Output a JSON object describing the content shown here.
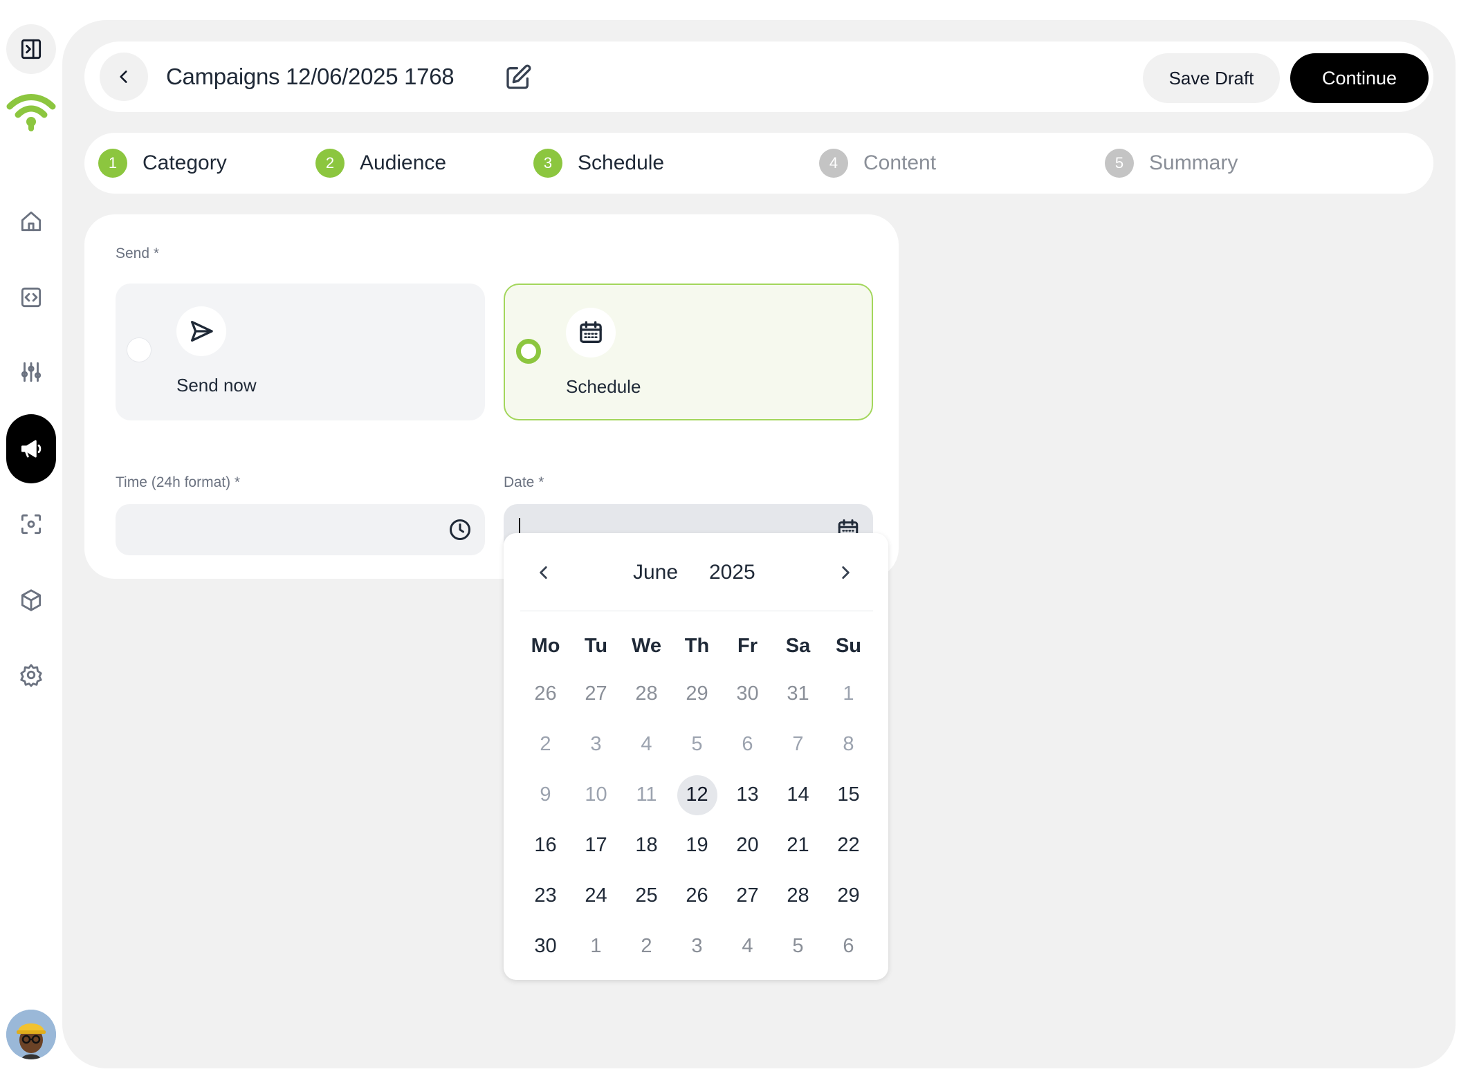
{
  "header": {
    "title": "Campaigns 12/06/2025 1768",
    "save_draft": "Save Draft",
    "continue": "Continue"
  },
  "steps": [
    {
      "num": "1",
      "label": "Category",
      "state": "done"
    },
    {
      "num": "2",
      "label": "Audience",
      "state": "done"
    },
    {
      "num": "3",
      "label": "Schedule",
      "state": "done"
    },
    {
      "num": "4",
      "label": "Content",
      "state": "todo"
    },
    {
      "num": "5",
      "label": "Summary",
      "state": "todo"
    }
  ],
  "send": {
    "label": "Send *",
    "options": [
      {
        "label": "Send now",
        "icon": "send-icon",
        "selected": false
      },
      {
        "label": "Schedule",
        "icon": "calendar-icon",
        "selected": true
      }
    ]
  },
  "time": {
    "label": "Time (24h format) *",
    "value": ""
  },
  "date": {
    "label": "Date *",
    "value": ""
  },
  "calendar": {
    "month": "June",
    "year": "2025",
    "weekdays": [
      "Mo",
      "Tu",
      "We",
      "Th",
      "Fr",
      "Sa",
      "Su"
    ],
    "weeks": [
      [
        "26",
        "27",
        "28",
        "29",
        "30",
        "31",
        "1"
      ],
      [
        "2",
        "3",
        "4",
        "5",
        "6",
        "7",
        "8"
      ],
      [
        "9",
        "10",
        "11",
        "12",
        "13",
        "14",
        "15"
      ],
      [
        "16",
        "17",
        "18",
        "19",
        "20",
        "21",
        "22"
      ],
      [
        "23",
        "24",
        "25",
        "26",
        "27",
        "28",
        "29"
      ],
      [
        "30",
        "1",
        "2",
        "3",
        "4",
        "5",
        "6"
      ]
    ],
    "today": "12"
  },
  "colors": {
    "accent": "#8cc63f",
    "primary_button": "#000000",
    "panel_bg": "#f1f1f1"
  }
}
